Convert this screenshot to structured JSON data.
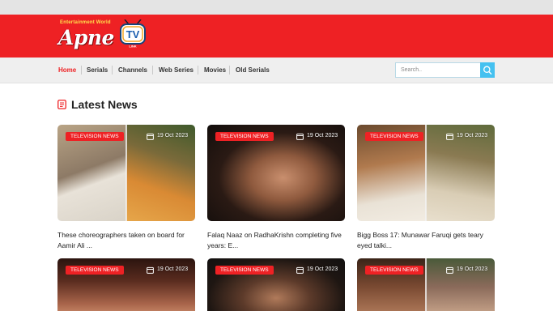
{
  "site": {
    "logo_tagline": "Entertainment World",
    "logo_word": "Apne",
    "logo_tv": "TV",
    "logo_tv_sub": "LINK"
  },
  "colors": {
    "brand_red": "#ee2124",
    "search_button": "#45c1f0",
    "nav_background": "#efefef",
    "top_strip": "#e4e4e4"
  },
  "nav": {
    "items": [
      {
        "label": "Home",
        "active": true
      },
      {
        "label": "Serials",
        "active": false
      },
      {
        "label": "Channels",
        "active": false
      },
      {
        "label": "Web Series",
        "active": false
      },
      {
        "label": "Movies",
        "active": false
      },
      {
        "label": "Old Serials",
        "active": false
      }
    ]
  },
  "search": {
    "placeholder": "Search..",
    "button_icon": "search-icon"
  },
  "section": {
    "title": "Latest News",
    "icon": "newspaper-icon"
  },
  "cards": [
    {
      "badge": "TELEVISION NEWS",
      "date": "19 Oct 2023",
      "title": "These choreographers taken on board for Aamir Ali ..."
    },
    {
      "badge": "TELEVISION NEWS",
      "date": "19 Oct 2023",
      "title": "Falaq Naaz on RadhaKrishn completing five years: E..."
    },
    {
      "badge": "TELEVISION NEWS",
      "date": "19 Oct 2023",
      "title": "Bigg Boss 17: Munawar Faruqi gets teary eyed talki..."
    },
    {
      "badge": "TELEVISION NEWS",
      "date": "19 Oct 2023",
      "title": ""
    },
    {
      "badge": "TELEVISION NEWS",
      "date": "19 Oct 2023",
      "title": ""
    },
    {
      "badge": "TELEVISION NEWS",
      "date": "19 Oct 2023",
      "title": ""
    }
  ]
}
